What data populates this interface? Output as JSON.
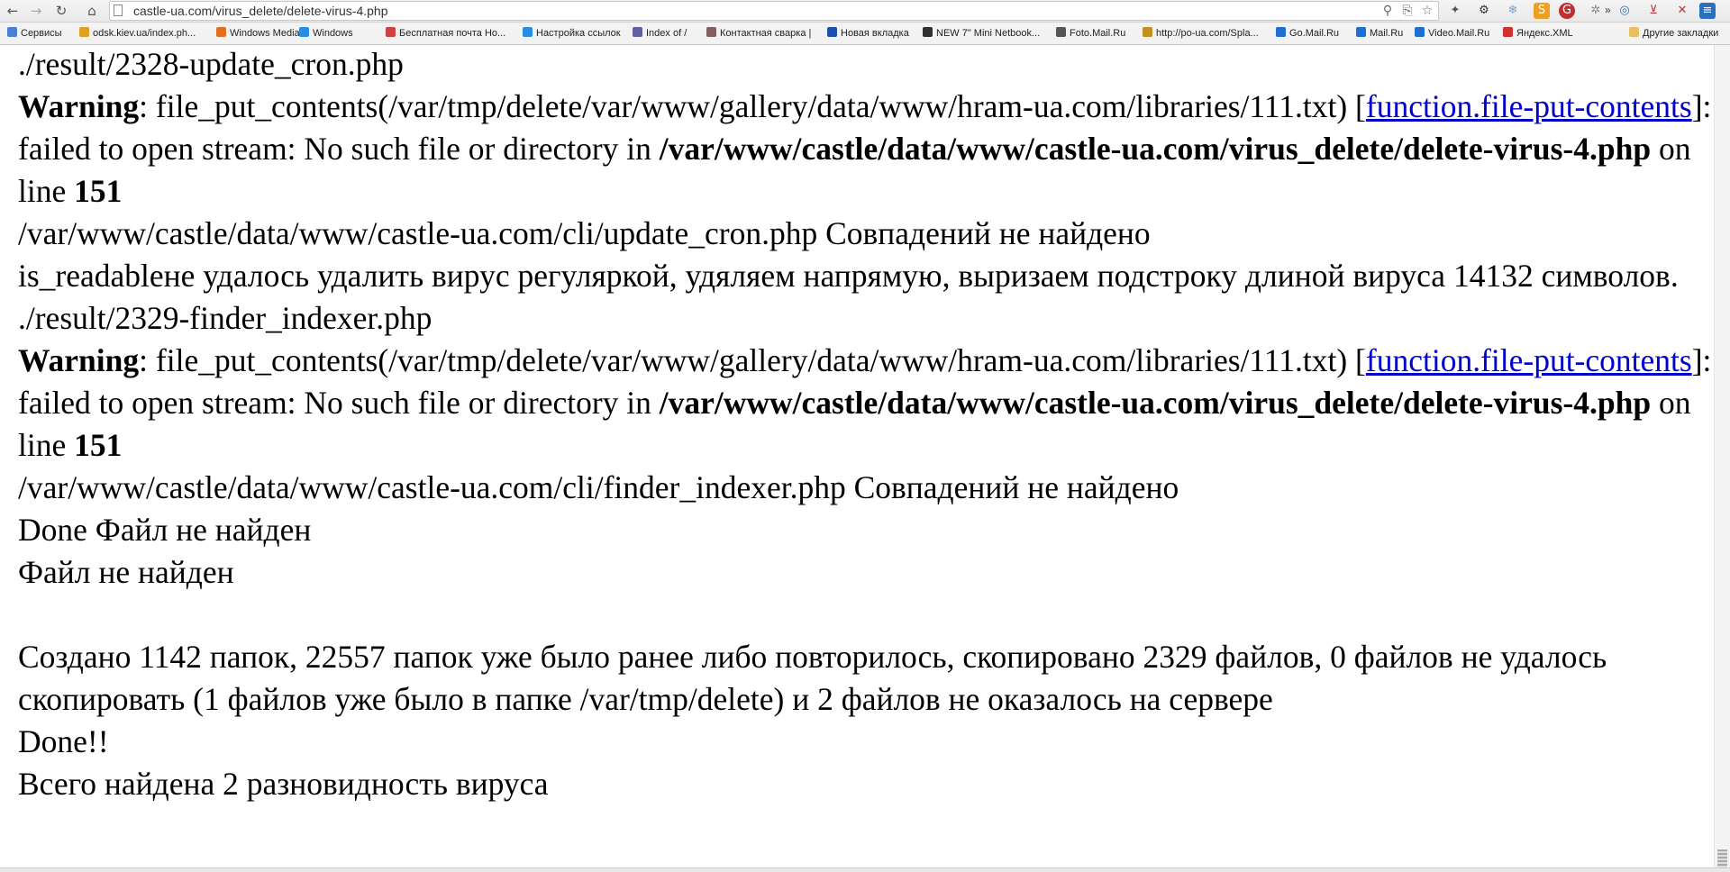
{
  "browser": {
    "url": "castle-ua.com/virus_delete/delete-virus-4.php",
    "bookmarks": [
      {
        "label": "Сервисы",
        "color": "#4a7fd4"
      },
      {
        "label": "odsk.kiev.ua/index.ph...",
        "color": "#e0a020"
      },
      {
        "label": "Windows Media",
        "color": "#e07020"
      },
      {
        "label": "Windows",
        "color": "#2a8ee0"
      },
      {
        "label": "Бесплатная почта Но...",
        "color": "#d04040"
      },
      {
        "label": "Настройка ссылок",
        "color": "#2a8ee0"
      },
      {
        "label": "Index of /",
        "color": "#6060a0"
      },
      {
        "label": "Контактная сварка |",
        "color": "#806060"
      },
      {
        "label": "Новая вкладка",
        "color": "#1e4fb0"
      },
      {
        "label": "NEW 7\" Mini Netbook...",
        "color": "#303030"
      },
      {
        "label": "Foto.Mail.Ru",
        "color": "#555"
      },
      {
        "label": "http://po-ua.com/Spla...",
        "color": "#c09020"
      },
      {
        "label": "Go.Mail.Ru",
        "color": "#1e6fd0"
      },
      {
        "label": "Mail.Ru",
        "color": "#1e6fd0"
      },
      {
        "label": "Video.Mail.Ru",
        "color": "#1e6fd0"
      },
      {
        "label": "Яндекс.XML",
        "color": "#d03030"
      }
    ],
    "more_label": "»",
    "other_bookmarks": "Другие закладки"
  },
  "content": {
    "line1": "./result/2328-update_cron.php",
    "warn1": {
      "label": "Warning",
      "text1": ": file_put_contents(/var/tmp/delete/var/www/gallery/data/www/hram-ua.com/libraries/111.txt) [",
      "link": "function.file-put-contents",
      "text2": "]: failed to open stream: No such file or directory in ",
      "path": "/var/www/castle/data/www/castle-ua.com/virus_delete/delete-virus-4.php",
      "online": " on line ",
      "lineno": "151"
    },
    "line_nomatch1": "/var/www/castle/data/www/castle-ua.com/cli/update_cron.php Совпадений не найдено",
    "line_readable": "is_readableне удалось удалить вирус регуляркой, удяляем напрямую, выризаем подстроку длиной вируса 14132 символов.",
    "line2": "./result/2329-finder_indexer.php",
    "warn2": {
      "label": "Warning",
      "text1": ": file_put_contents(/var/tmp/delete/var/www/gallery/data/www/hram-ua.com/libraries/111.txt) [",
      "link": "function.file-put-contents",
      "text2": "]: failed to open stream: No such file or directory in ",
      "path": "/var/www/castle/data/www/castle-ua.com/virus_delete/delete-virus-4.php",
      "online": " on line ",
      "lineno": "151"
    },
    "line_nomatch2": "/var/www/castle/data/www/castle-ua.com/cli/finder_indexer.php Совпадений не найдено",
    "line_done1": "Done Файл не найден",
    "line_notfound": "Файл не найден",
    "summary": "Создано 1142 папок, 22557 папок уже было ранее либо повторилось, скопировано 2329 файлов, 0 файлов не удалось скопировать (1 файлов уже было в папке /var/tmp/delete) и 2 файлов не оказалось на сервере",
    "done2": "Done!!",
    "total": "Всего найдена 2 разновидность вируса"
  }
}
